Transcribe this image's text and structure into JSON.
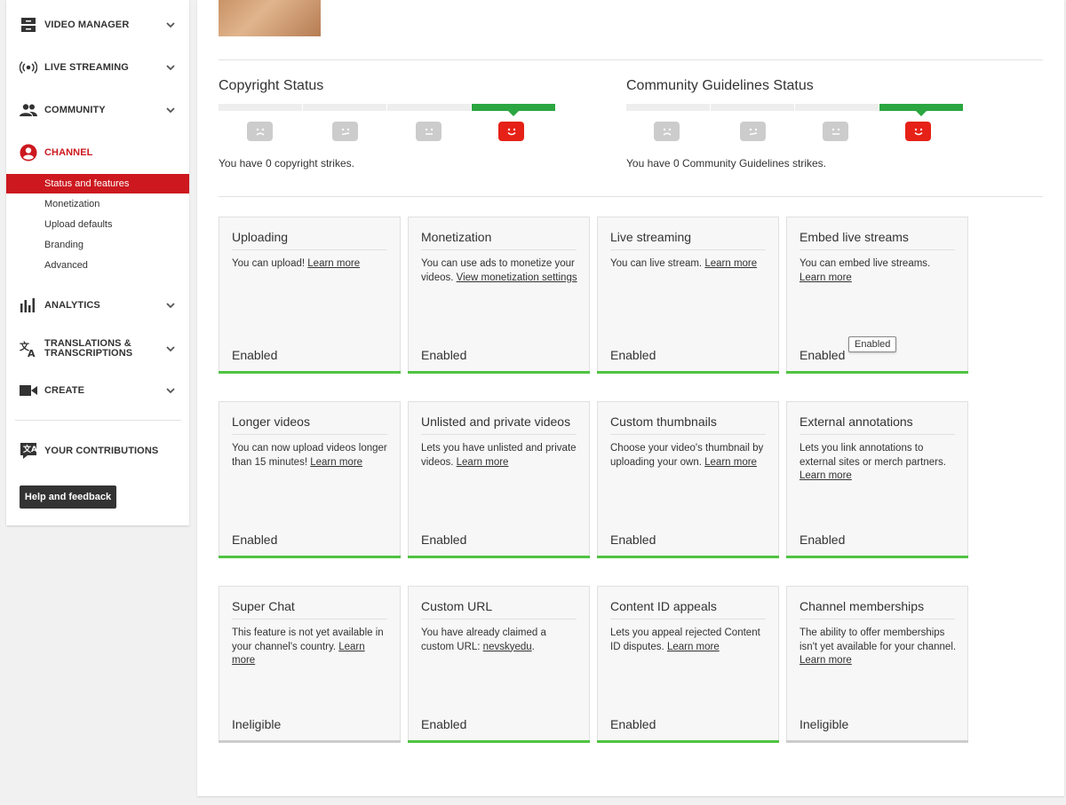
{
  "sidebar": {
    "items": [
      {
        "label": "VIDEO MANAGER",
        "icon": "video-manager-icon"
      },
      {
        "label": "LIVE STREAMING",
        "icon": "live-streaming-icon"
      },
      {
        "label": "COMMUNITY",
        "icon": "community-icon"
      },
      {
        "label": "CHANNEL",
        "icon": "channel-icon"
      },
      {
        "label": "ANALYTICS",
        "icon": "analytics-icon"
      },
      {
        "label": "TRANSLATIONS & TRANSCRIPTIONS",
        "icon": "translations-icon"
      },
      {
        "label": "CREATE",
        "icon": "create-icon"
      },
      {
        "label": "YOUR CONTRIBUTIONS",
        "icon": "contributions-icon"
      }
    ],
    "channel_sub": [
      "Status and features",
      "Monetization",
      "Upload defaults",
      "Branding",
      "Advanced"
    ],
    "help_button": "Help and feedback"
  },
  "copyright": {
    "title": "Copyright Status",
    "text": "You have 0 copyright strikes."
  },
  "community_guidelines": {
    "title": "Community Guidelines Status",
    "text": "You have 0 Community Guidelines strikes."
  },
  "cards": [
    {
      "title": "Uploading",
      "desc": "You can upload!",
      "link": "Learn more",
      "status": "Enabled"
    },
    {
      "title": "Monetization",
      "desc": "You can use ads to monetize your videos.",
      "link": "View monetization settings",
      "status": "Enabled"
    },
    {
      "title": "Live streaming",
      "desc": "You can live stream.",
      "link": "Learn more",
      "status": "Enabled"
    },
    {
      "title": "Embed live streams",
      "desc": "You can embed live streams.",
      "link": "Learn more",
      "status": "Enabled",
      "tooltip": "Enabled"
    },
    {
      "title": "Longer videos",
      "desc": "You can now upload videos longer than 15 minutes!",
      "link": "Learn more",
      "status": "Enabled"
    },
    {
      "title": "Unlisted and private videos",
      "desc": "Lets you have unlisted and private videos.",
      "link": "Learn more",
      "status": "Enabled"
    },
    {
      "title": "Custom thumbnails",
      "desc": "Choose your video's thumbnail by uploading your own.",
      "link": "Learn more",
      "status": "Enabled"
    },
    {
      "title": "External annotations",
      "desc": "Lets you link annotations to external sites or merch partners.",
      "link": "Learn more",
      "status": "Enabled"
    },
    {
      "title": "Super Chat",
      "desc": "This feature is not yet available in your channel's country.",
      "link": "Learn more",
      "status": "Ineligible"
    },
    {
      "title": "Custom URL",
      "desc": "You have already claimed a custom URL:",
      "link": "nevskyedu",
      "suffix": ".",
      "status": "Enabled"
    },
    {
      "title": "Content ID appeals",
      "desc": "Lets you appeal rejected Content ID disputes.",
      "link": "Learn more",
      "status": "Enabled"
    },
    {
      "title": "Channel memberships",
      "desc": "The ability to offer memberships isn't yet available for your channel.",
      "link": "Learn more",
      "status": "Ineligible"
    }
  ],
  "colors": {
    "accent_red": "#cc181e",
    "enabled_green": "#4fc443",
    "strike_green": "#2ba640",
    "ineligible_gray": "#cccccc"
  }
}
